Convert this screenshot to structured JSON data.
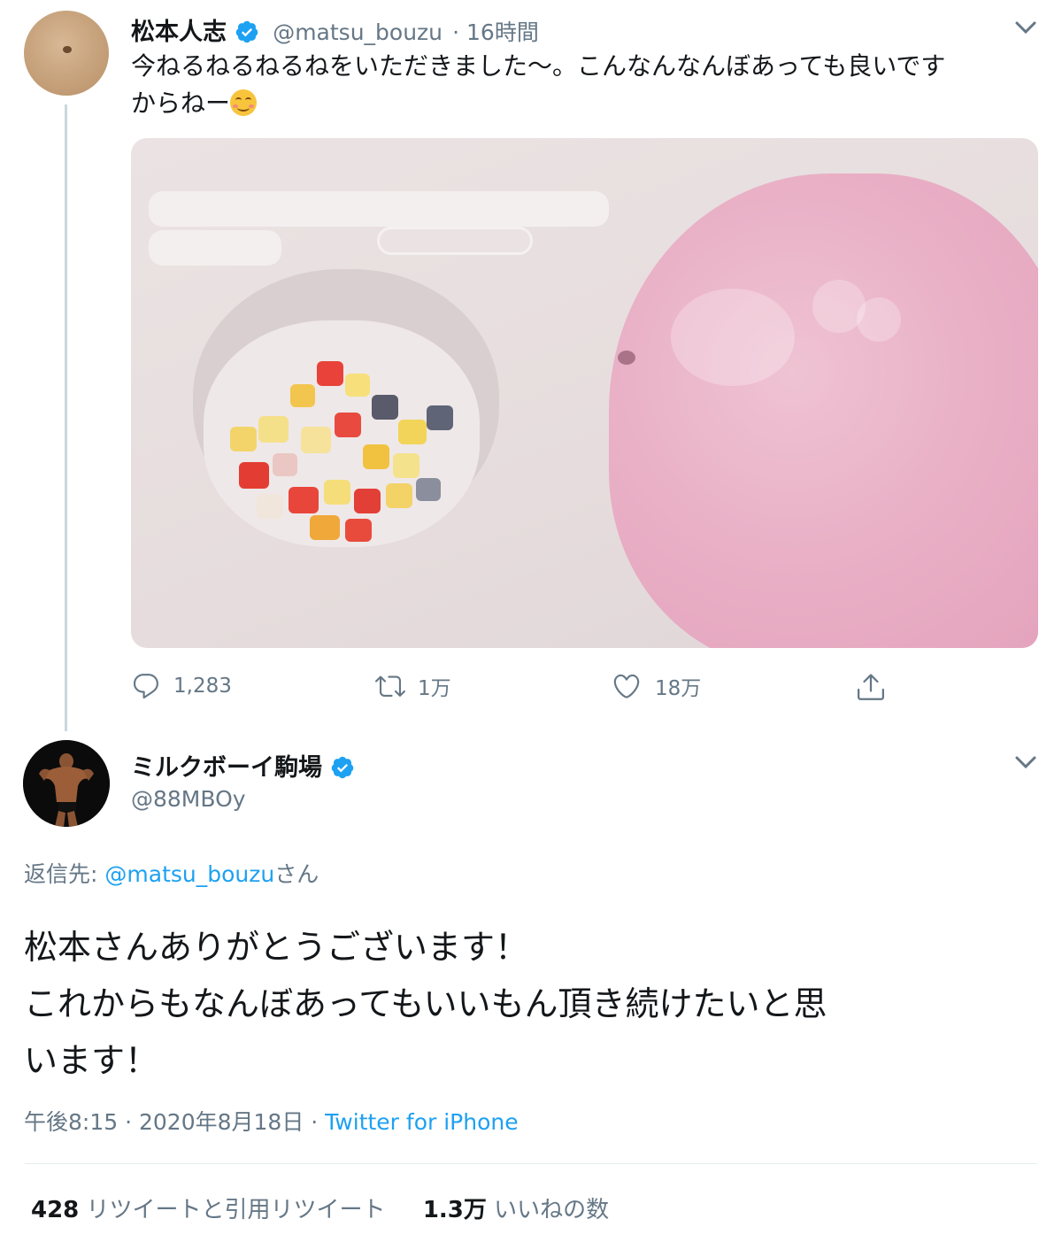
{
  "tweet1": {
    "display_name": "松本人志",
    "handle": "@matsu_bouzu",
    "time": "· 16時間",
    "text_line1": "今ねるねるねるねをいただきました〜。こんなんなんぼあっても良いです",
    "text_line2": "からねー",
    "actions": {
      "replies": "1,283",
      "retweets": "1万",
      "likes": "18万"
    }
  },
  "tweet2": {
    "display_name": "ミルクボーイ駒場",
    "handle": "@88MBOy",
    "reply_label": "返信先:",
    "reply_to": "@matsu_bouzu",
    "reply_suffix": "さん",
    "text_line1": "松本さんありがとうございます！",
    "text_line2": "これからもなんぼあってもいいもん頂き続けたいと思",
    "text_line3": "います！",
    "timestamp": "午後8:15 · 2020年8月18日 ·",
    "source": "Twitter for iPhone",
    "retweet_count": "428",
    "retweet_label": "リツイートと引用リツイート",
    "like_count": "1.3万",
    "like_label": "いいねの数"
  },
  "icons": [
    "chevron-down-icon",
    "verified-badge-icon",
    "reply-icon",
    "retweet-icon",
    "like-icon",
    "share-icon",
    "smiling-face-emoji"
  ],
  "colors": {
    "link": "#1da1f2",
    "verified": "#1da1f2",
    "secondary_text": "#657786",
    "primary_text": "#14171a",
    "thread_line": "#ccd6dd"
  }
}
